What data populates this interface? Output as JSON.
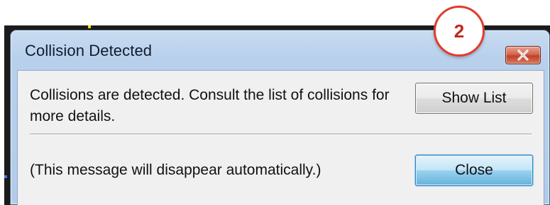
{
  "dialog": {
    "title": "Collision Detected",
    "message": "Collisions are detected. Consult the list of collisions for more details.",
    "footer_note": "(This message will disappear automatically.)",
    "close_glyph": "✕"
  },
  "buttons": {
    "show_list": "Show List",
    "close": "Close"
  },
  "annotation": {
    "step_number": "2"
  },
  "colors": {
    "accent_badge": "#e03c2e",
    "title_bar": "#b8d0ec",
    "client_area": "#f0f0f0",
    "default_button": "#98d1ef",
    "close_x_button": "#c0402a"
  }
}
